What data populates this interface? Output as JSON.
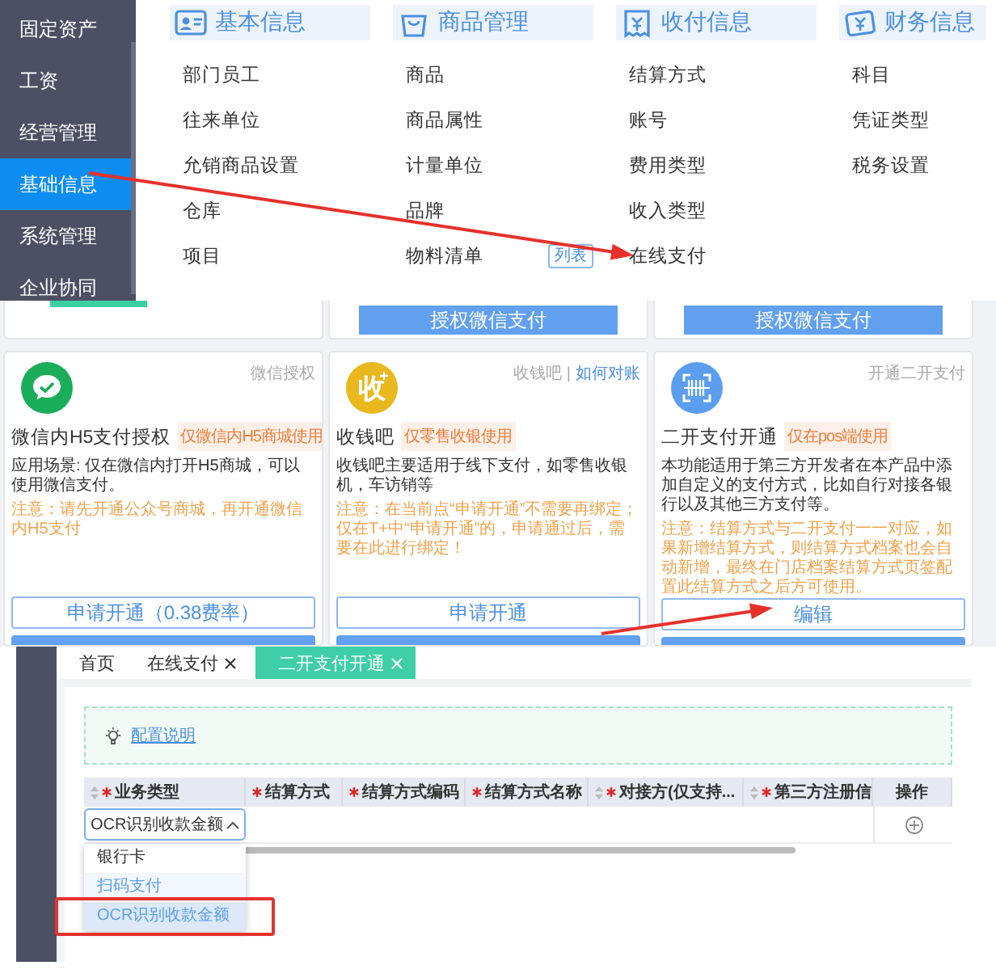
{
  "settings_menu": {
    "sidebar": [
      {
        "label": "固定资产",
        "selected": false
      },
      {
        "label": "工资",
        "selected": false
      },
      {
        "label": "经营管理",
        "selected": false
      },
      {
        "label": "基础信息",
        "selected": true
      },
      {
        "label": "系统管理",
        "selected": false
      },
      {
        "label": "企业协同",
        "selected": false
      }
    ],
    "columns": [
      {
        "title": "基本信息",
        "items": [
          {
            "label": "部门员工"
          },
          {
            "label": "往来单位"
          },
          {
            "label": "允销商品设置"
          },
          {
            "label": "仓库"
          },
          {
            "label": "项目"
          }
        ]
      },
      {
        "title": "商品管理",
        "items": [
          {
            "label": "商品"
          },
          {
            "label": "商品属性"
          },
          {
            "label": "计量单位"
          },
          {
            "label": "品牌"
          },
          {
            "label": "物料清单",
            "badge": "列表"
          }
        ]
      },
      {
        "title": "收付信息",
        "items": [
          {
            "label": "结算方式"
          },
          {
            "label": "账号"
          },
          {
            "label": "费用类型"
          },
          {
            "label": "收入类型"
          },
          {
            "label": "在线支付"
          }
        ]
      },
      {
        "title": "财务信息",
        "items": [
          {
            "label": "科目"
          },
          {
            "label": "凭证类型"
          },
          {
            "label": "税务设置"
          }
        ]
      }
    ]
  },
  "payment_cards": {
    "top_buttons": [
      "授权微信支付",
      "授权微信支付"
    ],
    "cards": [
      {
        "corner": "微信授权",
        "title": "微信内H5支付授权",
        "tag": "仅微信内H5商城使用",
        "description": "应用场景: 仅在微信内打开H5商城，可以使用微信支付。",
        "note": "注意：请先开通公众号商城，再开通微信内H5支付",
        "button": "申请开通（0.38费率）"
      },
      {
        "corner": "收钱吧 |",
        "corner_link": "如何对账",
        "icon_text": "收",
        "title": "收钱吧",
        "tag": "仅零售收银使用",
        "description": "收钱吧主要适用于线下支付，如零售收银机，车访销等",
        "note": "注意：在当前点“申请开通”不需要再绑定；仅在T+中“申请开通”的，申请通过后，需要在此进行绑定！",
        "button": "申请开通"
      },
      {
        "corner": "开通二开支付",
        "title": "二开支付开通",
        "tag": "仅在pos端使用",
        "description": "本功能适用于第三方开发者在本产品中添加自定义的支付方式，比如自行对接各银行以及其他三方支付等。",
        "note": "注意：结算方式与二开支付一一对应，如果新增结算方式，则结算方式档案也会自动新增，最终在门店档案结算方式页签配置此结算方式之后方可使用。",
        "button": "编辑"
      }
    ]
  },
  "editor": {
    "tabs": [
      {
        "label": "首页",
        "closable": false,
        "selected": false
      },
      {
        "label": "在线支付",
        "closable": true,
        "selected": false
      },
      {
        "label": "二开支付开通",
        "closable": true,
        "selected": true
      }
    ],
    "info_link": "配置说明",
    "table": {
      "columns": [
        {
          "label": "业务类型",
          "required": true,
          "sortable": true
        },
        {
          "label": "结算方式",
          "required": true,
          "sortable": false
        },
        {
          "label": "结算方式编码",
          "required": true,
          "sortable": false
        },
        {
          "label": "结算方式名称",
          "required": true,
          "sortable": false
        },
        {
          "label": "对接方(仅支持...",
          "required": true,
          "sortable": true
        },
        {
          "label": "第三方注册信",
          "required": true,
          "sortable": true
        },
        {
          "label": "操作",
          "required": false,
          "sortable": false
        }
      ],
      "rows": [
        {
          "business_type": {
            "value": "OCR识别收款金额",
            "expanded": true
          }
        }
      ]
    },
    "dropdown": {
      "options": [
        {
          "label": "银行卡",
          "selected": false,
          "hovered": false,
          "highlighted": false
        },
        {
          "label": "扫码支付",
          "selected": false,
          "hovered": true,
          "highlighted": false
        },
        {
          "label": "OCR识别收款金额",
          "selected": true,
          "hovered": false,
          "highlighted": true
        }
      ]
    }
  }
}
